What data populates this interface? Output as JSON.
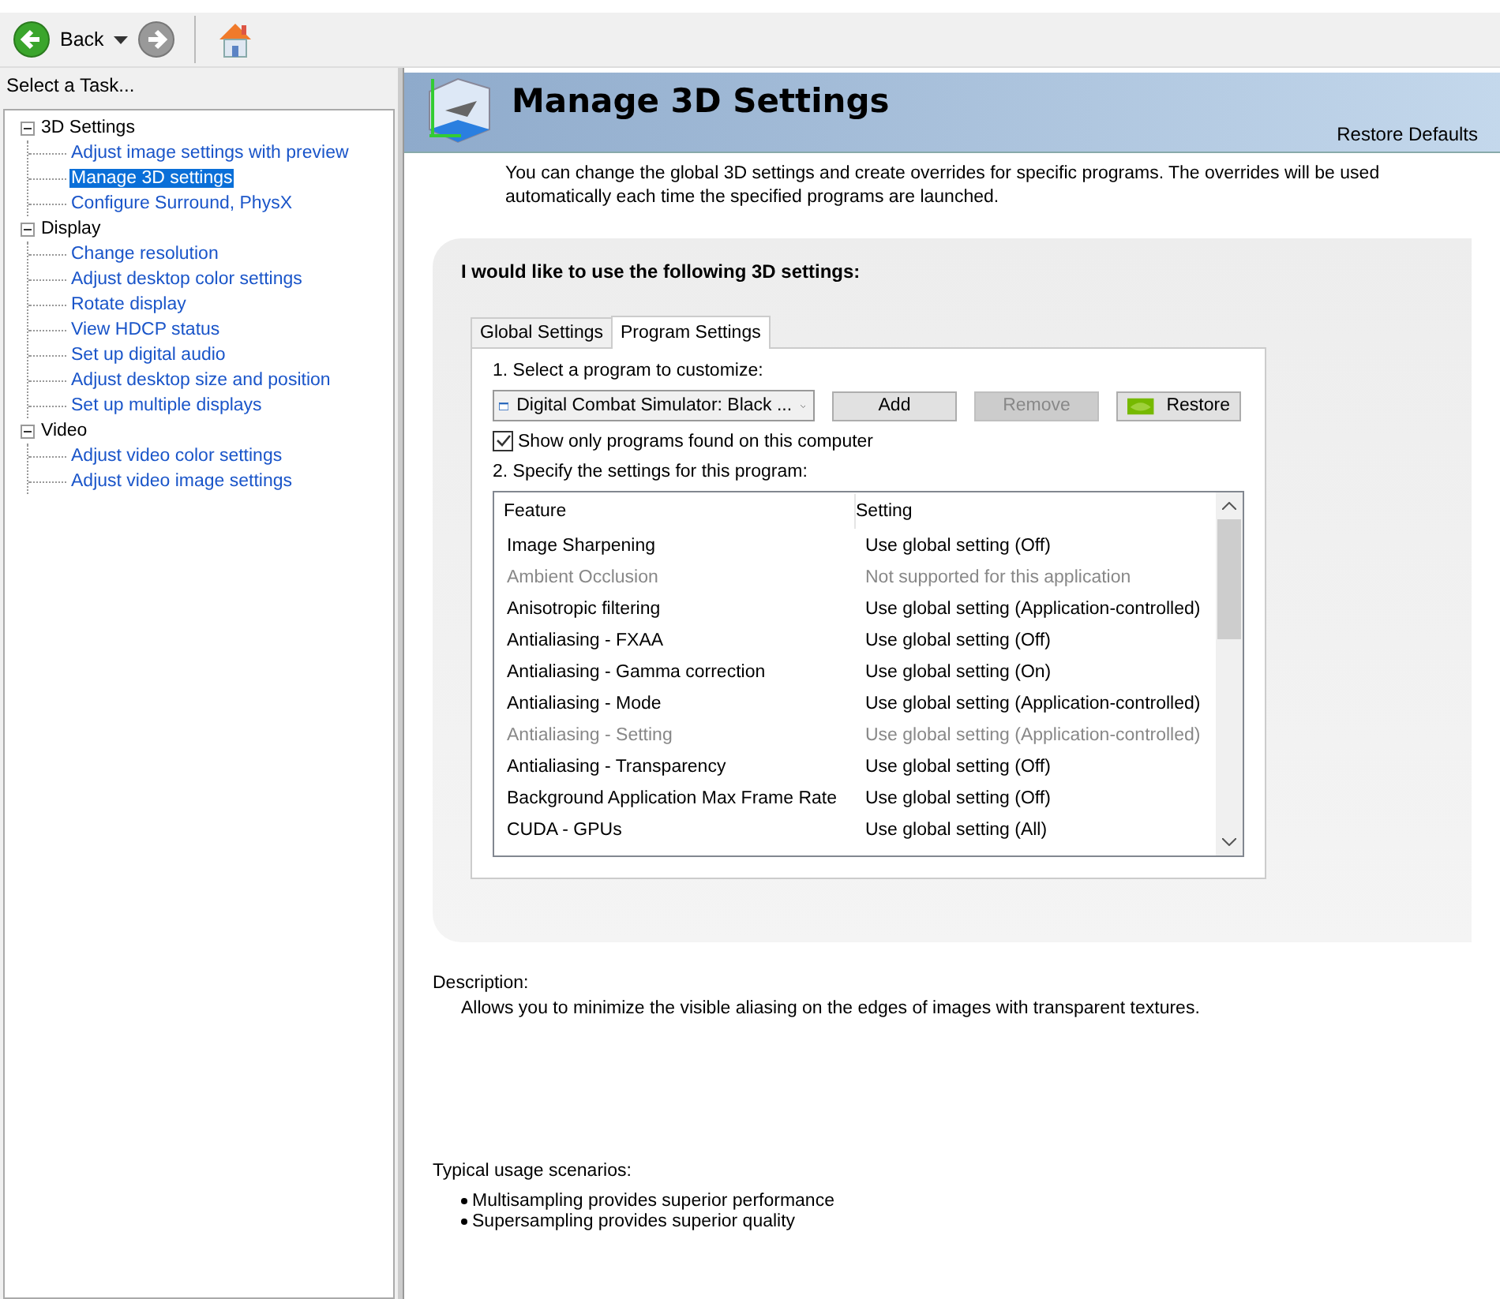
{
  "toolbar": {
    "back_label": "Back"
  },
  "sidebar": {
    "title": "Select a Task...",
    "tree": [
      {
        "label": "3D Settings",
        "expanded": true,
        "children": [
          {
            "label": "Adjust image settings with preview",
            "selected": false
          },
          {
            "label": "Manage 3D settings",
            "selected": true
          },
          {
            "label": "Configure Surround, PhysX",
            "selected": false
          }
        ]
      },
      {
        "label": "Display",
        "expanded": true,
        "children": [
          {
            "label": "Change resolution",
            "selected": false
          },
          {
            "label": "Adjust desktop color settings",
            "selected": false
          },
          {
            "label": "Rotate display",
            "selected": false
          },
          {
            "label": "View HDCP status",
            "selected": false
          },
          {
            "label": "Set up digital audio",
            "selected": false
          },
          {
            "label": "Adjust desktop size and position",
            "selected": false
          },
          {
            "label": "Set up multiple displays",
            "selected": false
          }
        ]
      },
      {
        "label": "Video",
        "expanded": true,
        "children": [
          {
            "label": "Adjust video color settings",
            "selected": false
          },
          {
            "label": "Adjust video image settings",
            "selected": false
          }
        ]
      }
    ]
  },
  "header": {
    "title": "Manage 3D Settings",
    "restore_defaults": "Restore Defaults"
  },
  "intro": "You can change the global 3D settings and create overrides for specific programs. The overrides will be used automatically each time the specified programs are launched.",
  "panel": {
    "heading": "I would like to use the following 3D settings:",
    "tabs": [
      {
        "label": "Global Settings",
        "selected": false
      },
      {
        "label": "Program Settings",
        "selected": true
      }
    ],
    "step1": "1. Select a program to customize:",
    "program_dropdown": {
      "value": "Digital Combat Simulator: Black ..."
    },
    "buttons": [
      {
        "label": "Add",
        "disabled": false,
        "kind": "plain"
      },
      {
        "label": "Remove",
        "disabled": true,
        "kind": "plain"
      },
      {
        "label": "Restore",
        "disabled": false,
        "kind": "logo"
      }
    ],
    "show_only_found": {
      "label": "Show only programs found on this computer",
      "checked": true
    },
    "step2": "2. Specify the settings for this program:",
    "table": {
      "columns": [
        "Feature",
        "Setting"
      ],
      "rows": [
        {
          "feature": "Image Sharpening",
          "setting": "Use global setting (Off)",
          "disabled": false
        },
        {
          "feature": "Ambient Occlusion",
          "setting": "Not supported for this application",
          "disabled": true
        },
        {
          "feature": "Anisotropic filtering",
          "setting": "Use global setting (Application-controlled)",
          "disabled": false
        },
        {
          "feature": "Antialiasing - FXAA",
          "setting": "Use global setting (Off)",
          "disabled": false
        },
        {
          "feature": "Antialiasing - Gamma correction",
          "setting": "Use global setting (On)",
          "disabled": false
        },
        {
          "feature": "Antialiasing - Mode",
          "setting": "Use global setting (Application-controlled)",
          "disabled": false
        },
        {
          "feature": "Antialiasing - Setting",
          "setting": "Use global setting (Application-controlled)",
          "disabled": true
        },
        {
          "feature": "Antialiasing - Transparency",
          "setting": "Use global setting (Off)",
          "disabled": false
        },
        {
          "feature": "Background Application Max Frame Rate",
          "setting": "Use global setting (Off)",
          "disabled": false
        },
        {
          "feature": "CUDA - GPUs",
          "setting": "Use global setting (All)",
          "disabled": false
        }
      ]
    }
  },
  "description": {
    "label": "Description:",
    "text": "Allows you to minimize the visible aliasing on the edges of images with transparent textures."
  },
  "usage": {
    "label": "Typical usage scenarios:",
    "items": [
      "Multisampling provides superior performance",
      "Supersampling provides superior quality"
    ]
  }
}
